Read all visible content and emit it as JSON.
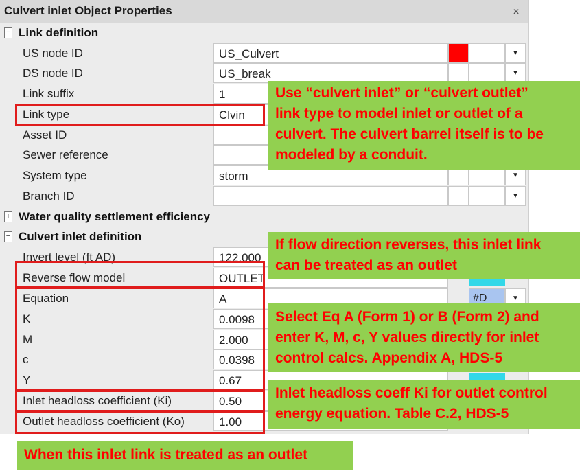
{
  "window": {
    "title": "Culvert inlet Object Properties",
    "close_glyph": "×"
  },
  "sections": {
    "link_definition": {
      "label": "Link definition",
      "toggle": "−"
    },
    "water_quality": {
      "label": "Water quality settlement efficiency",
      "toggle": "+"
    },
    "culvert_inlet": {
      "label": "Culvert inlet definition",
      "toggle": "−"
    }
  },
  "rows": {
    "us_node": {
      "label": "US node ID",
      "value": "US_Culvert"
    },
    "ds_node": {
      "label": "DS node ID",
      "value": "US_break"
    },
    "link_suffix": {
      "label": "Link suffix",
      "value": "1"
    },
    "link_type": {
      "label": "Link type",
      "value": "Clvin"
    },
    "asset_id": {
      "label": "Asset ID",
      "value": ""
    },
    "sewer_ref": {
      "label": "Sewer reference",
      "value": ""
    },
    "system_type": {
      "label": "System type",
      "value": "storm"
    },
    "branch_id": {
      "label": "Branch ID",
      "value": ""
    },
    "invert": {
      "label": "Invert level (ft AD)",
      "value": "122.000"
    },
    "reverse_flow": {
      "label": "Reverse flow model",
      "value": "OUTLET"
    },
    "equation": {
      "label": "Equation",
      "value": "A",
      "flag": "#D"
    },
    "k": {
      "label": "K",
      "value": "0.0098"
    },
    "m": {
      "label": "M",
      "value": "2.000"
    },
    "c": {
      "label": "c",
      "value": "0.0398"
    },
    "y": {
      "label": "Y",
      "value": "0.67"
    },
    "ki": {
      "label": "Inlet headloss coefficient (Ki)",
      "value": "0.50"
    },
    "ko": {
      "label": "Outlet headloss coefficient (Ko)",
      "value": "1.00"
    }
  },
  "dropdown_glyph": "▼",
  "colors": {
    "us_node_flag": "#ff0000",
    "callout_bg": "#92d050",
    "callout_text": "#ff0000",
    "highlight_box": "#e01c1c",
    "cyan_flag": "#33d8e8"
  },
  "callouts": {
    "link_type": {
      "line1": "Use “culvert inlet” or “culvert outlet”",
      "line2": "link type to model inlet or outlet of a",
      "line3": "culvert. The culvert barrel itself is to be",
      "line4": "modeled by a conduit."
    },
    "reverse": {
      "line1": "If flow direction reverses, this inlet link",
      "line2": "can be treated as an outlet"
    },
    "equation": {
      "line1": "Select Eq A (Form 1) or B (Form 2) and",
      "line2": "enter K, M, c, Y values directly for inlet",
      "line3": "control calcs. Appendix A, HDS-5"
    },
    "ki": {
      "line1": "Inlet headloss coeff Ki for outlet control",
      "line2": "energy equation. Table C.2, HDS-5"
    },
    "ko": {
      "line1": "When this inlet link is treated as an outlet"
    }
  }
}
